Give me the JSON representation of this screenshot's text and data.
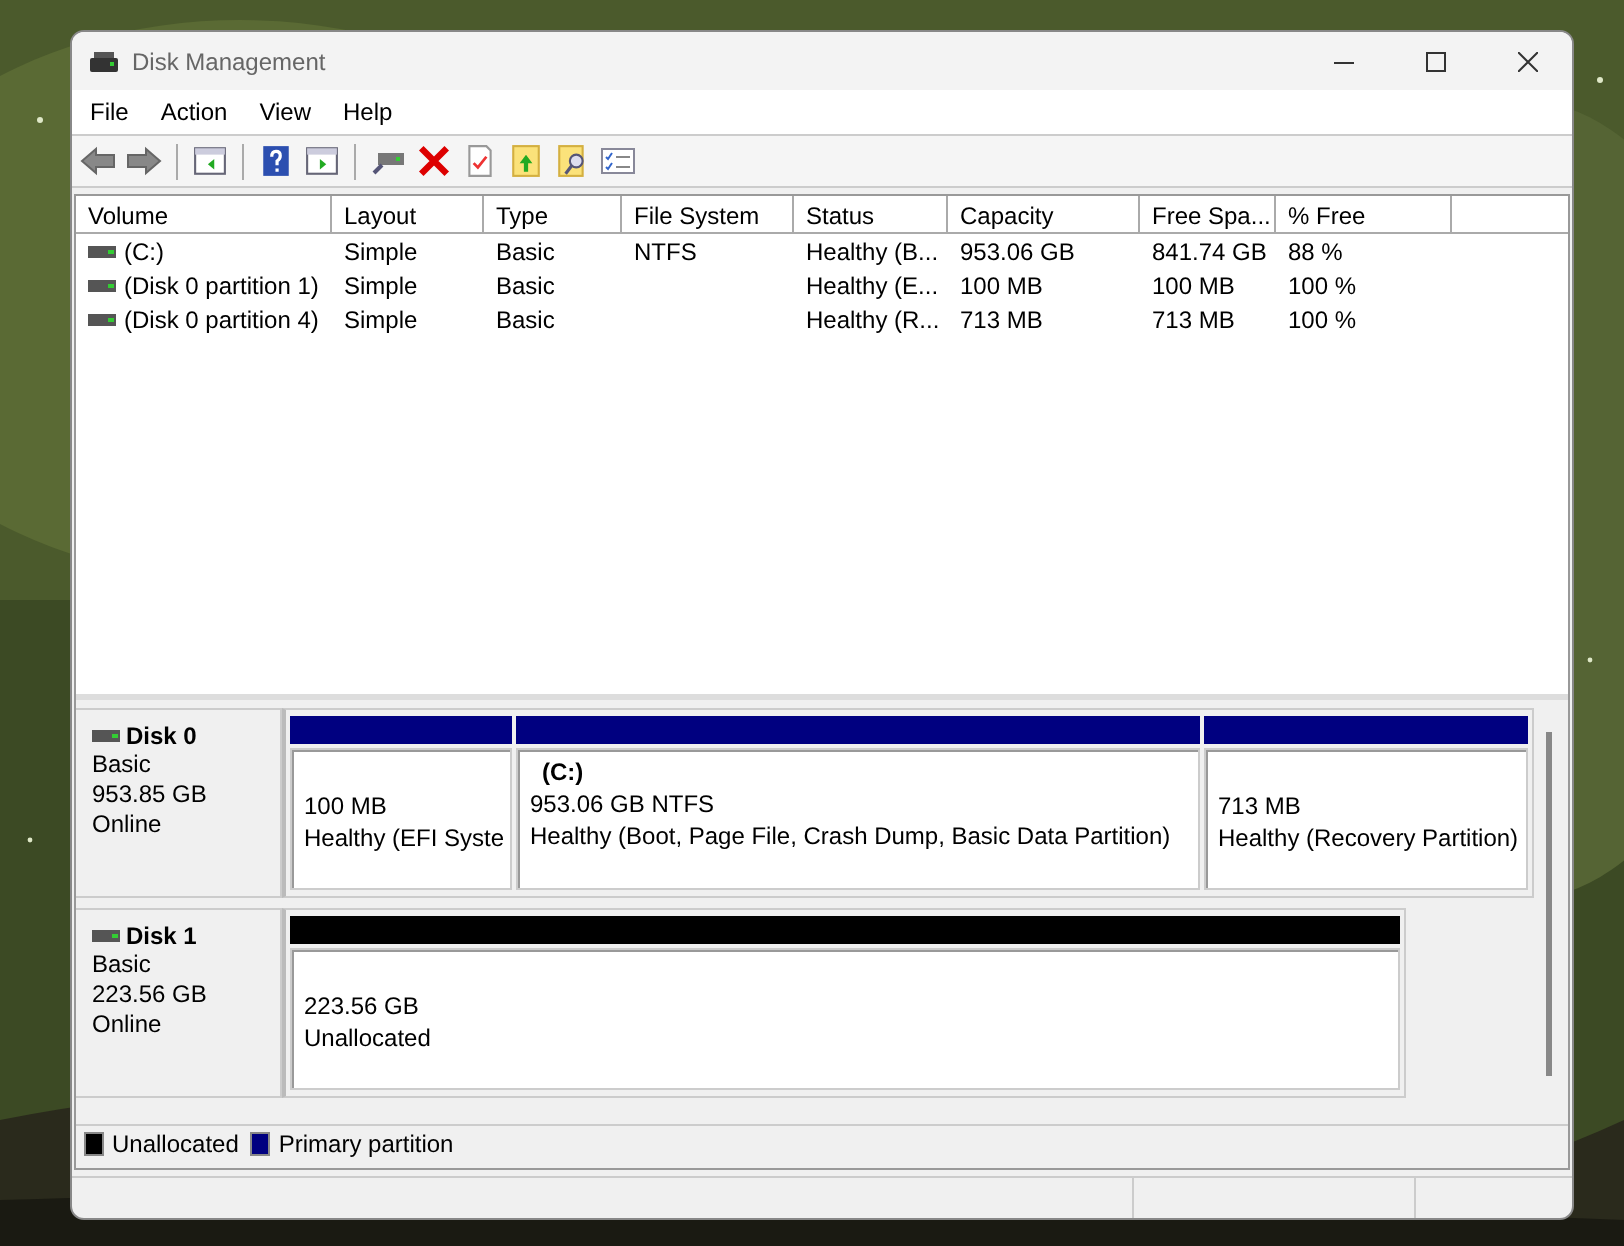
{
  "window": {
    "title": "Disk Management"
  },
  "menu": [
    "File",
    "Action",
    "View",
    "Help"
  ],
  "table": {
    "columns": [
      "Volume",
      "Layout",
      "Type",
      "File System",
      "Status",
      "Capacity",
      "Free Spa...",
      "% Free"
    ],
    "rows": [
      {
        "cells": [
          "(C:)",
          "Simple",
          "Basic",
          "NTFS",
          "Healthy (B...",
          "953.06 GB",
          "841.74 GB",
          "88 %"
        ]
      },
      {
        "cells": [
          "(Disk 0 partition 1)",
          "Simple",
          "Basic",
          "",
          "Healthy (E...",
          "100 MB",
          "100 MB",
          "100 %"
        ]
      },
      {
        "cells": [
          "(Disk 0 partition 4)",
          "Simple",
          "Basic",
          "",
          "Healthy (R...",
          "713 MB",
          "713 MB",
          "100 %"
        ]
      }
    ]
  },
  "disks": [
    {
      "name": "Disk 0",
      "type": "Basic",
      "size": "953.85 GB",
      "status": "Online",
      "partitions": [
        {
          "size": "100 MB",
          "status": "Healthy (EFI Syste",
          "color": "#000080"
        },
        {
          "label": "(C:)",
          "size": "953.06 GB NTFS",
          "status": "Healthy (Boot, Page File, Crash Dump, Basic Data Partition)",
          "color": "#000080"
        },
        {
          "size": "713 MB",
          "status": "Healthy (Recovery Partition)",
          "color": "#000080"
        }
      ]
    },
    {
      "name": "Disk 1",
      "type": "Basic",
      "size": "223.56 GB",
      "status": "Online",
      "partitions": [
        {
          "size": "223.56 GB",
          "status": "Unallocated",
          "color": "#000000"
        }
      ]
    }
  ],
  "legend": [
    {
      "label": "Unallocated",
      "color": "#000000"
    },
    {
      "label": "Primary partition",
      "color": "#000080"
    }
  ]
}
